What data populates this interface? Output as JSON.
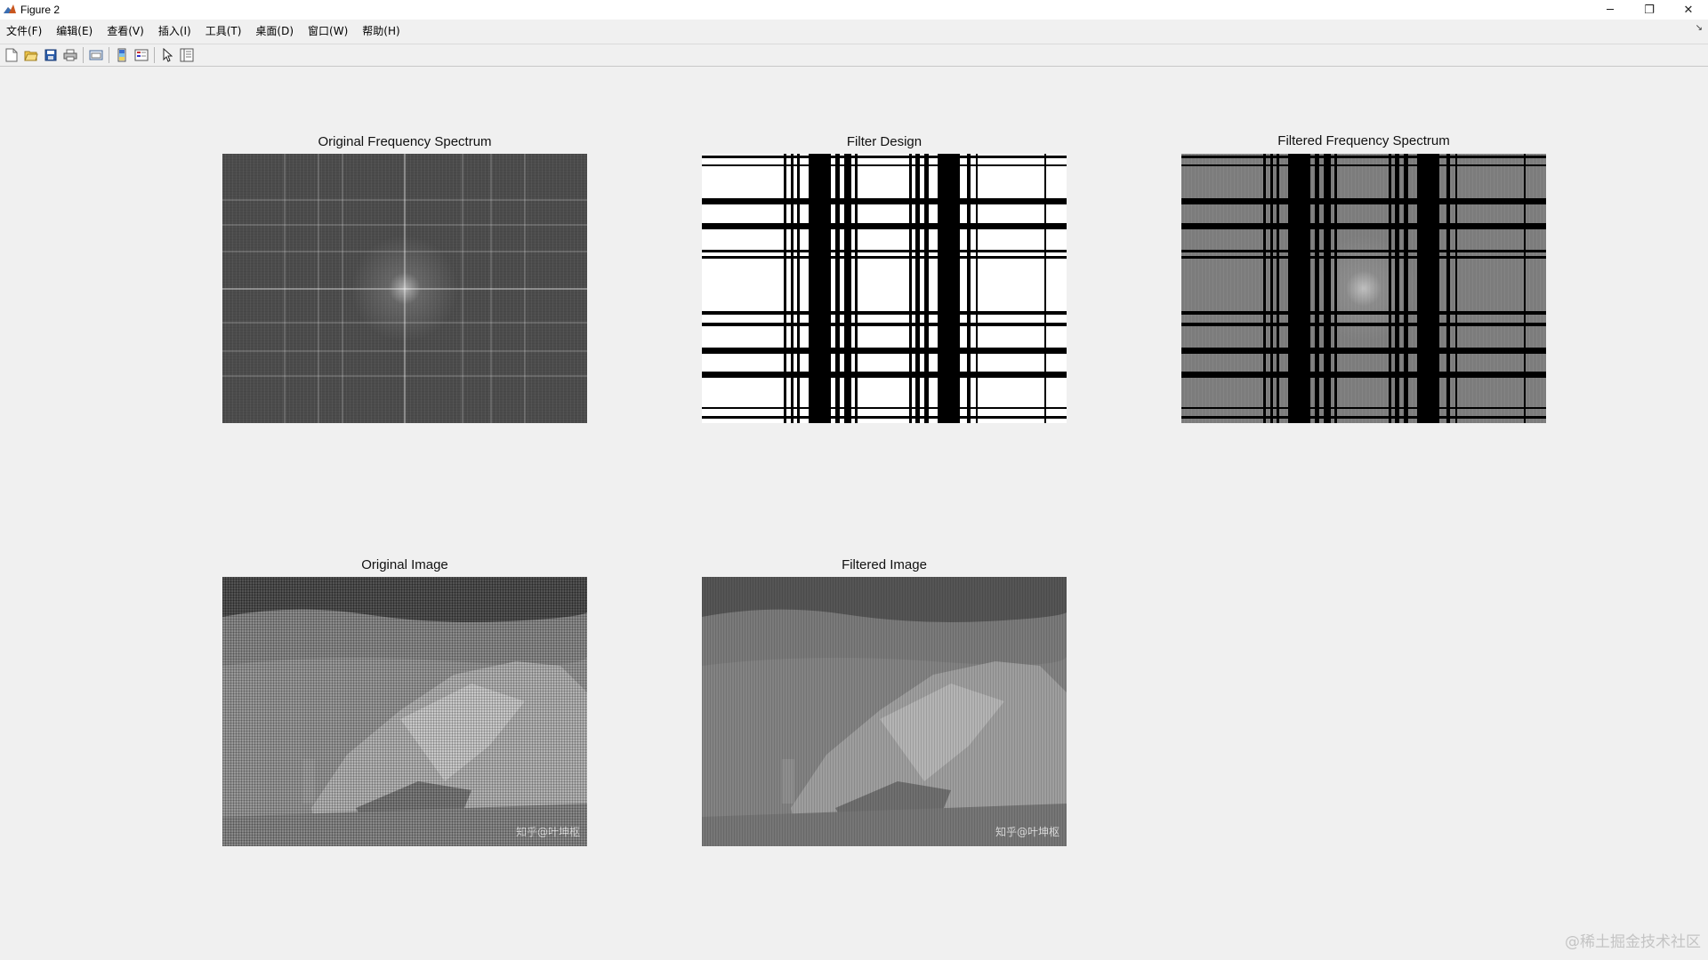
{
  "window": {
    "title": "Figure 2",
    "controls": {
      "minimize": "─",
      "restore": "❐",
      "close": "✕"
    }
  },
  "menubar": {
    "items": [
      "文件(F)",
      "编辑(E)",
      "查看(V)",
      "插入(I)",
      "工具(T)",
      "桌面(D)",
      "窗口(W)",
      "帮助(H)"
    ]
  },
  "toolbar": {
    "buttons": [
      "new-figure",
      "open-file",
      "save",
      "print",
      "link-plot",
      "insert-colorbar",
      "insert-legend",
      "edit-plot-pointer",
      "property-editor"
    ]
  },
  "subplots": [
    {
      "title": "Original Frequency Spectrum",
      "content": "spectrum"
    },
    {
      "title": "Filter Design",
      "content": "filter-mask"
    },
    {
      "title": "Filtered Frequency Spectrum",
      "content": "filtered-spectrum"
    },
    {
      "title": "Original Image",
      "content": "moon-image",
      "watermark": "知乎@叶坤枢"
    },
    {
      "title": "Filtered Image",
      "content": "moon-image",
      "watermark": "知乎@叶坤枢"
    }
  ],
  "page_watermark": "@稀土掘金技术社区",
  "colors": {
    "background": "#f0f0f0",
    "titlebar": "#ffffff",
    "text": "#000000"
  }
}
